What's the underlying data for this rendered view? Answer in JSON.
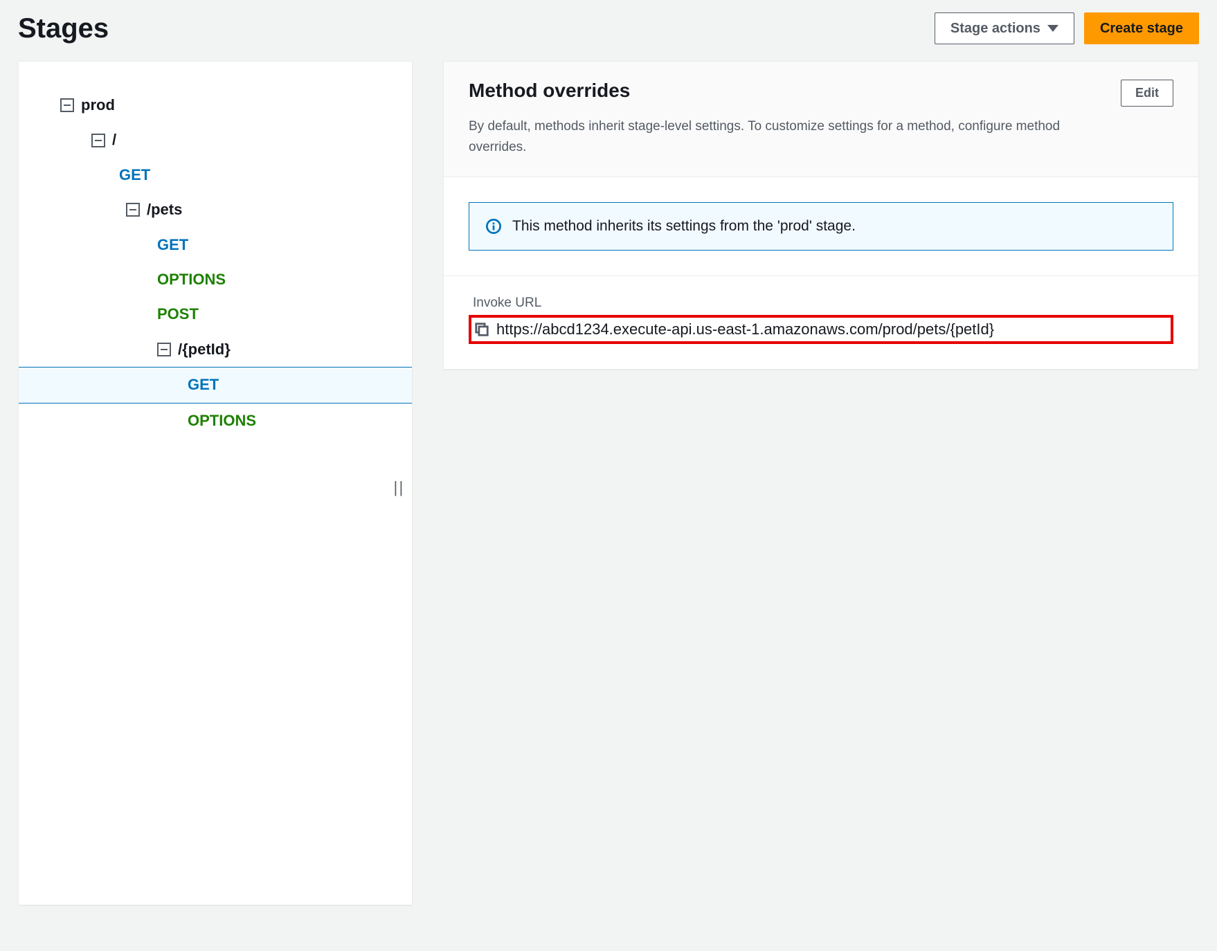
{
  "header": {
    "title": "Stages",
    "stage_actions_label": "Stage actions",
    "create_stage_label": "Create stage"
  },
  "tree": {
    "stage_name": "prod",
    "root_resource": "/",
    "root_methods": {
      "get": "GET"
    },
    "pets_resource": "/pets",
    "pets_methods": {
      "get": "GET",
      "options": "OPTIONS",
      "post": "POST"
    },
    "petid_resource": "/{petId}",
    "petid_methods": {
      "get": "GET",
      "options": "OPTIONS"
    }
  },
  "detail": {
    "title": "Method overrides",
    "edit_label": "Edit",
    "description": "By default, methods inherit stage-level settings. To customize settings for a method, configure method overrides.",
    "info_message": "This method inherits its settings from the 'prod' stage.",
    "invoke_label": "Invoke URL",
    "invoke_url": "https://abcd1234.execute-api.us-east-1.amazonaws.com/prod/pets/{petId}"
  }
}
